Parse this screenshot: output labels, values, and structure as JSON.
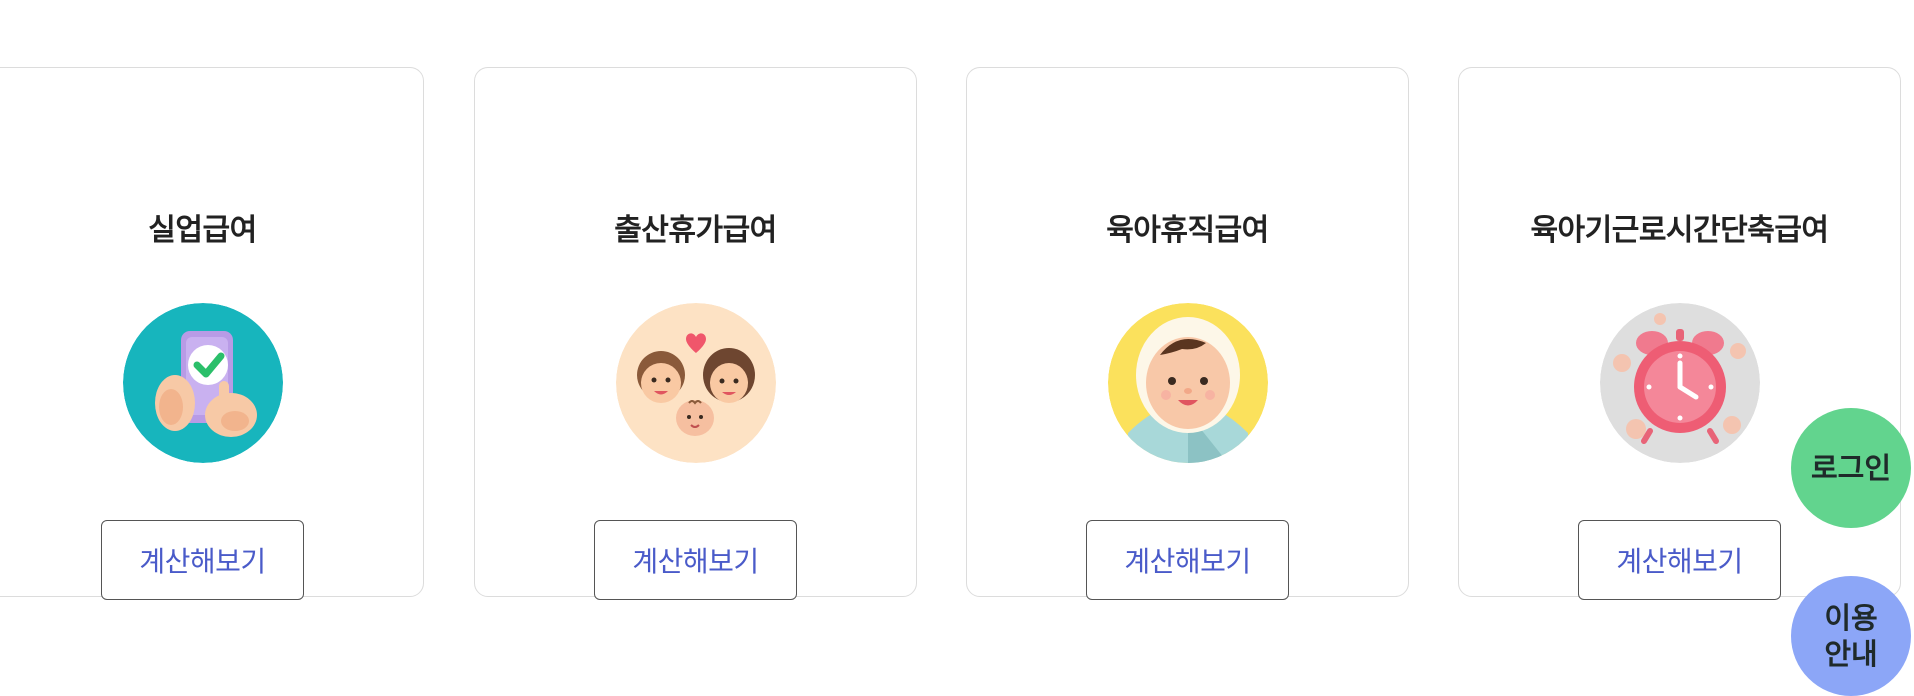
{
  "cards": [
    {
      "title": "실업급여",
      "icon": "phone-check-icon",
      "icon_bg": "#17b5bd",
      "button": "계산해보기"
    },
    {
      "title": "출산휴가급여",
      "icon": "family-icon",
      "icon_bg": "#fde2c4",
      "button": "계산해보기"
    },
    {
      "title": "육아휴직급여",
      "icon": "baby-icon",
      "icon_bg": "#fbe15c",
      "button": "계산해보기"
    },
    {
      "title": "육아기근로시간단축급여",
      "icon": "alarm-clock-icon",
      "icon_bg": "#dedede",
      "button": "계산해보기"
    }
  ],
  "floating": {
    "login_label": "로그인",
    "guide_line1": "이용",
    "guide_line2": "안내"
  },
  "colors": {
    "button_text": "#4a5bc9",
    "login_bg": "#62d48e",
    "guide_bg": "#8ca6f7"
  }
}
